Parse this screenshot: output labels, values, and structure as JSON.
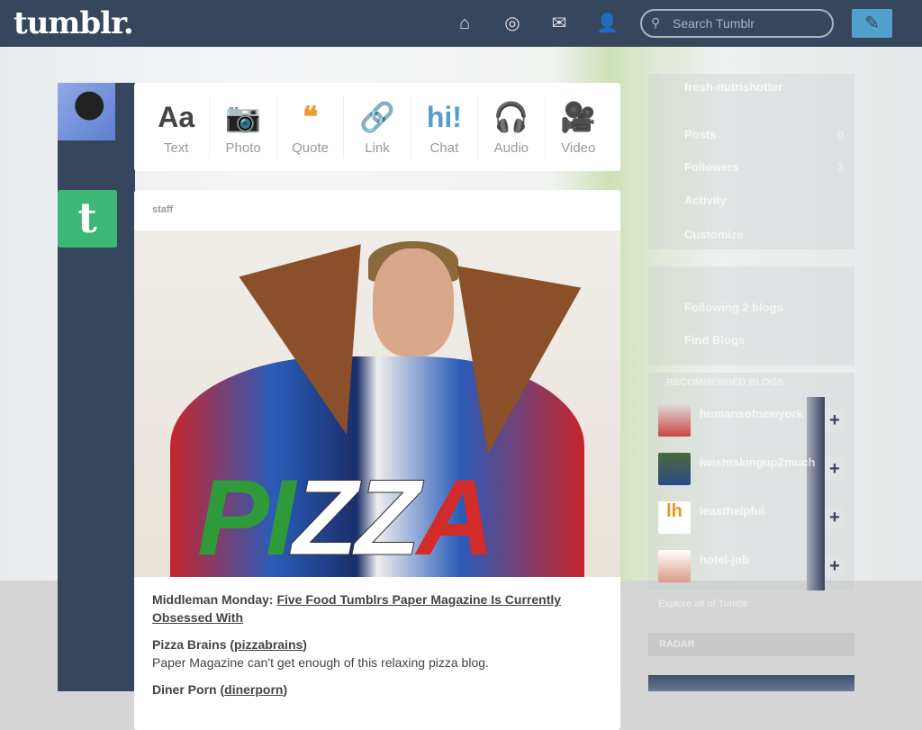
{
  "header": {
    "logo": "tumblr.",
    "search_placeholder": "Search Tumblr",
    "icons": [
      "home-icon",
      "compass-icon",
      "mail-icon",
      "account-icon"
    ],
    "compose_icon": "pencil-icon",
    "bg_color": "#36465d",
    "compose_color": "#529ecc"
  },
  "post_types": [
    {
      "label": "Text",
      "glyph": "Aa",
      "color": "#444444"
    },
    {
      "label": "Photo",
      "glyph": "📷",
      "color": "#d95e40"
    },
    {
      "label": "Quote",
      "glyph": "❝",
      "color": "#f2992e"
    },
    {
      "label": "Link",
      "glyph": "🔗",
      "color": "#56bc8a"
    },
    {
      "label": "Chat",
      "glyph": "hi!",
      "color": "#529ecc"
    },
    {
      "label": "Audio",
      "glyph": "🎧",
      "color": "#a77dc2"
    },
    {
      "label": "Video",
      "glyph": "🎥",
      "color": "#748089"
    }
  ],
  "post": {
    "author": "staff",
    "image_text": "PIZZA",
    "title_prefix": "Middleman Monday:",
    "title_link": "Five Food Tumblrs Paper Magazine Is Currently Obsessed With",
    "items": [
      {
        "name": "Pizza Brains",
        "handle": "pizzabrains",
        "desc": "Paper Magazine can't get enough of this relaxing pizza blog."
      },
      {
        "name": "Diner Porn",
        "handle": "dinerporn",
        "desc": ""
      }
    ]
  },
  "sidebar": {
    "blog_name": "fresh-nutrishotter",
    "blog_items": [
      {
        "label": "Posts",
        "count": "0"
      },
      {
        "label": "Followers",
        "count": "3"
      },
      {
        "label": "Activity",
        "count": ""
      },
      {
        "label": "Customize",
        "count": ""
      }
    ],
    "following": "Following 2 blogs",
    "find_blogs": "Find Blogs",
    "recommended_header": "RECOMMENDED BLOGS",
    "recommended": [
      {
        "name": "humansofnewyork"
      },
      {
        "name": "iwishtakingup2much"
      },
      {
        "name": "leasthelpful"
      },
      {
        "name": "hotel-job"
      }
    ],
    "explore": "Explore all of Tumblr",
    "radar": "RADAR"
  }
}
